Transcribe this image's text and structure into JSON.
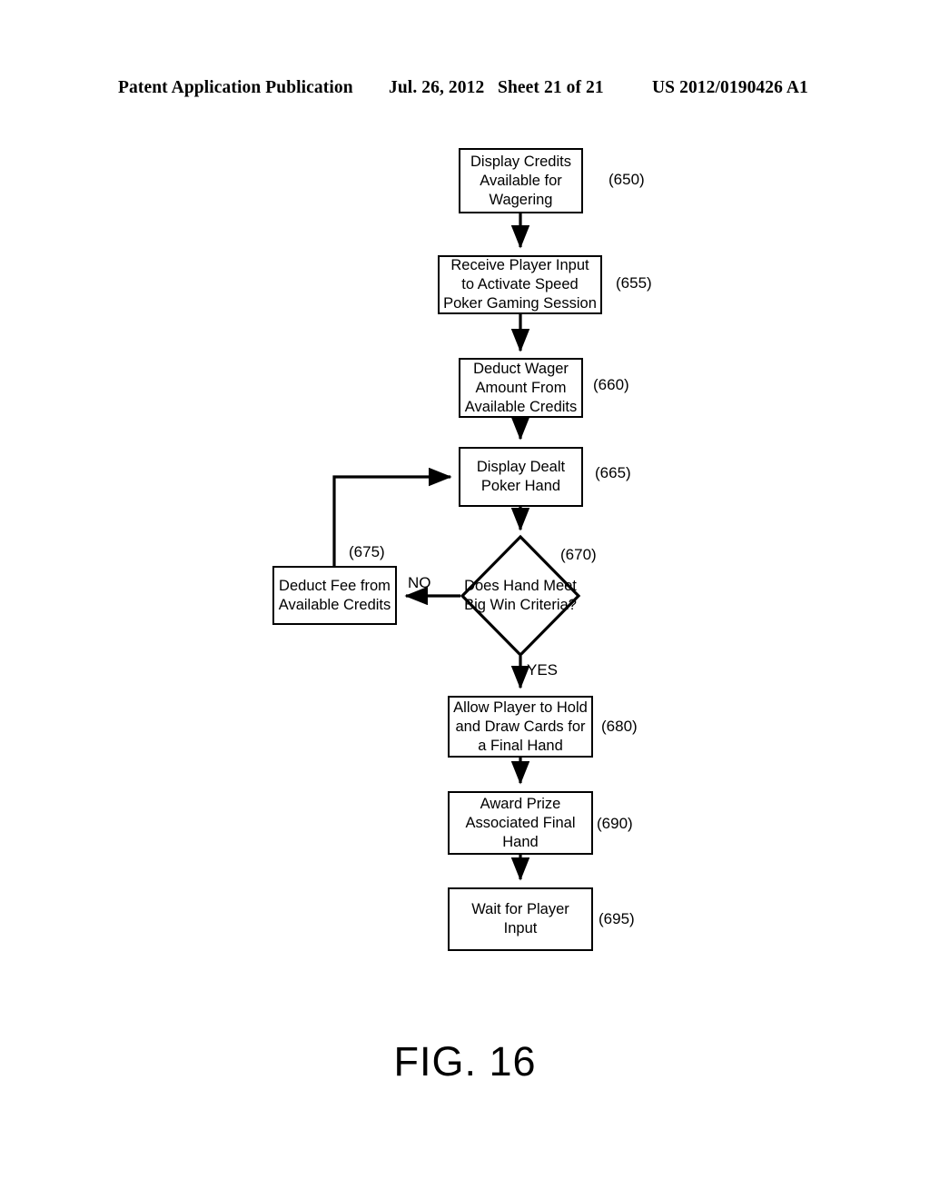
{
  "header": {
    "publication": "Patent Application Publication",
    "date": "Jul. 26, 2012",
    "sheet": "Sheet 21 of 21",
    "patent_number": "US 2012/0190426 A1"
  },
  "figure": {
    "caption": "FIG. 16",
    "type": "flowchart"
  },
  "flowchart": {
    "nodes": [
      {
        "id": "650",
        "shape": "process",
        "text": "Display Credits Available for Wagering",
        "ref": "(650)"
      },
      {
        "id": "655",
        "shape": "process",
        "text": "Receive Player Input to Activate Speed Poker Gaming Session",
        "ref": "(655)"
      },
      {
        "id": "660",
        "shape": "process",
        "text": "Deduct Wager Amount From Available Credits",
        "ref": "(660)"
      },
      {
        "id": "665",
        "shape": "process",
        "text": "Display Dealt Poker Hand",
        "ref": "(665)"
      },
      {
        "id": "670",
        "shape": "decision",
        "text": "Does Hand Meet Big Win Criteria?",
        "ref": "(670)"
      },
      {
        "id": "675",
        "shape": "process",
        "text": "Deduct Fee from Available Credits",
        "ref": "(675)"
      },
      {
        "id": "680",
        "shape": "process",
        "text": "Allow Player to Hold and Draw Cards for a Final Hand",
        "ref": "(680)"
      },
      {
        "id": "690",
        "shape": "process",
        "text": "Award Prize Associated Final Hand",
        "ref": "(690)"
      },
      {
        "id": "695",
        "shape": "process",
        "text": "Wait for Player Input",
        "ref": "(695)"
      }
    ],
    "edge_labels": {
      "no": "NO",
      "yes": "YES"
    },
    "edges": [
      {
        "from": "650",
        "to": "655",
        "label": ""
      },
      {
        "from": "655",
        "to": "660",
        "label": ""
      },
      {
        "from": "660",
        "to": "665",
        "label": ""
      },
      {
        "from": "665",
        "to": "670",
        "label": ""
      },
      {
        "from": "670",
        "to": "675",
        "label": "NO"
      },
      {
        "from": "670",
        "to": "680",
        "label": "YES"
      },
      {
        "from": "675",
        "to": "665",
        "label": ""
      },
      {
        "from": "680",
        "to": "690",
        "label": ""
      },
      {
        "from": "690",
        "to": "695",
        "label": ""
      }
    ]
  },
  "colors": {
    "ink": "#000000",
    "page": "#ffffff"
  }
}
